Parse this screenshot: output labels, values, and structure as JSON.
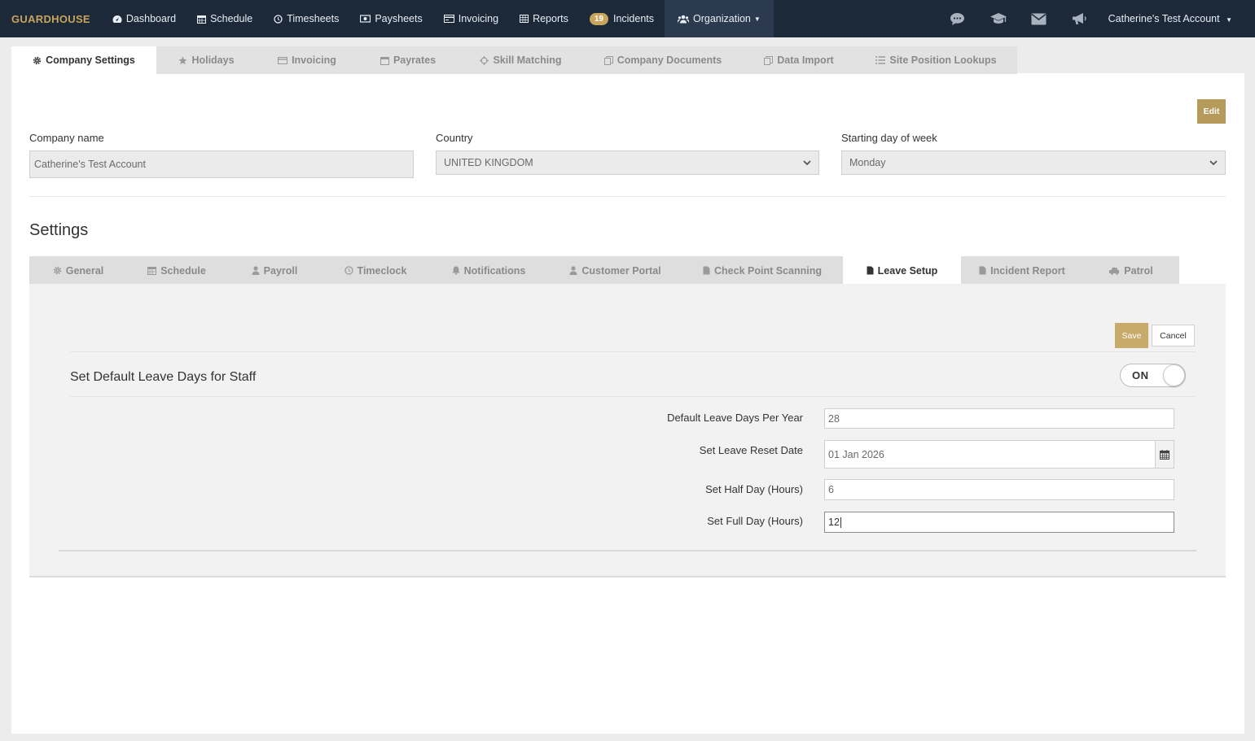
{
  "brand": "GUARDHOUSE",
  "nav": {
    "dashboard": "Dashboard",
    "schedule": "Schedule",
    "timesheets": "Timesheets",
    "paysheets": "Paysheets",
    "invoicing": "Invoicing",
    "reports": "Reports",
    "incidents_count": "19",
    "incidents": "Incidents",
    "organization": "Organization",
    "account": "Catherine's Test Account",
    "icons": [
      "chat-icon",
      "graduation-cap-icon",
      "envelope-icon",
      "megaphone-icon"
    ]
  },
  "top_tabs": {
    "company_settings": "Company Settings",
    "holidays": "Holidays",
    "invoicing": "Invoicing",
    "payrates": "Payrates",
    "skill_matching": "Skill Matching",
    "company_documents": "Company Documents",
    "data_import": "Data Import",
    "site_position_lookups": "Site Position Lookups",
    "active": "Company Settings"
  },
  "company": {
    "edit_label": "Edit",
    "name_label": "Company name",
    "name_value": "Catherine's Test Account",
    "country_label": "Country",
    "country_value": "UNITED KINGDOM",
    "start_day_label": "Starting day of week",
    "start_day_value": "Monday"
  },
  "settings": {
    "title": "Settings",
    "tabs": {
      "general": "General",
      "schedule": "Schedule",
      "payroll": "Payroll",
      "timeclock": "Timeclock",
      "notifications": "Notifications",
      "customer_portal": "Customer Portal",
      "check_point_scanning": "Check Point Scanning",
      "leave_setup": "Leave Setup",
      "incident_report": "Incident Report",
      "patrol": "Patrol",
      "active": "Leave Setup"
    }
  },
  "leave": {
    "save_label": "Save",
    "cancel_label": "Cancel",
    "section_title": "Set Default Leave Days for Staff",
    "toggle_label": "ON",
    "days_per_year_label": "Default Leave Days Per Year",
    "days_per_year_value": "28",
    "reset_date_label": "Set Leave Reset Date",
    "reset_date_value": "01 Jan 2026",
    "half_day_label": "Set Half Day (Hours)",
    "half_day_value": "6",
    "full_day_label": "Set Full Day (Hours)",
    "full_day_value": "12"
  },
  "colors": {
    "navbar": "#1b2939",
    "accent": "#c8a45c",
    "edit_button": "#b59a5c"
  }
}
